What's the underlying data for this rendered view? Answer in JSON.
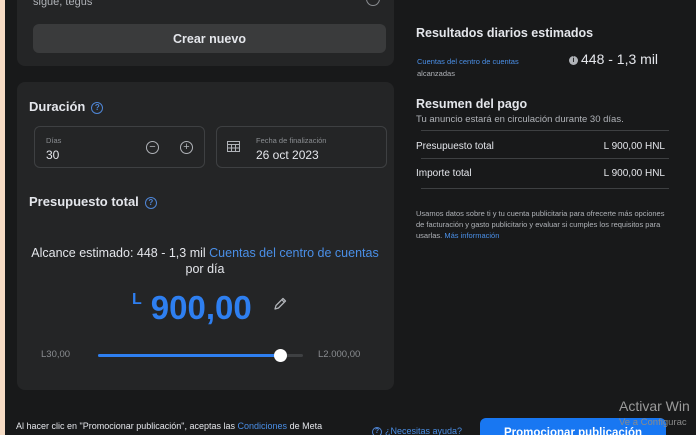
{
  "top_section": {
    "cut_text": "sigue, tegus",
    "create_button": "Crear nuevo"
  },
  "duration": {
    "heading": "Duración",
    "days_label": "Días",
    "days_value": "30",
    "end_date_label": "Fecha de finalización",
    "end_date_value": "26 oct 2023"
  },
  "budget": {
    "heading": "Presupuesto total",
    "reach_prefix": "Alcance estimado: 448 - 1,3 mil",
    "reach_link": "Cuentas del centro de cuentas",
    "reach_suffix": "por día",
    "currency_symbol": "L",
    "amount": "900,00",
    "slider_min": "L30,00",
    "slider_max": "L2.000,00",
    "slider_fraction": 0.89
  },
  "results": {
    "title": "Resultados diarios estimados",
    "accounts_link": "Cuentas del centro de cuentas",
    "accounts_suffix": "alcanzadas",
    "range": "448 - 1,3 mil"
  },
  "payment": {
    "title": "Resumen del pago",
    "subtitle": "Tu anuncio estará en circulación durante 30 días.",
    "rows": [
      {
        "label": "Presupuesto total",
        "value": "L 900,00 HNL"
      },
      {
        "label": "Importe total",
        "value": "L 900,00 HNL"
      }
    ],
    "disclaimer": "Usamos datos sobre ti y tu cuenta publicitaria para ofrecerte más opciones de facturación y gasto publicitario y evaluar si cumples los requisitos para usarlas.",
    "more_info": "Más información"
  },
  "footer": {
    "text_prefix": "Al hacer clic en \"Promocionar publicación\", aceptas las",
    "terms_link": "Condiciones",
    "text_suffix": "de Meta",
    "help_link": "¿Necesitas ayuda?",
    "promote_button": "Promocionar publicación"
  },
  "watermark": {
    "line1": "Activar Win",
    "line2": "Ve a Configurac"
  },
  "colors": {
    "accent": "#2e7ff0",
    "link": "#4a8fe7",
    "panel": "#242526",
    "background": "#18191a"
  }
}
